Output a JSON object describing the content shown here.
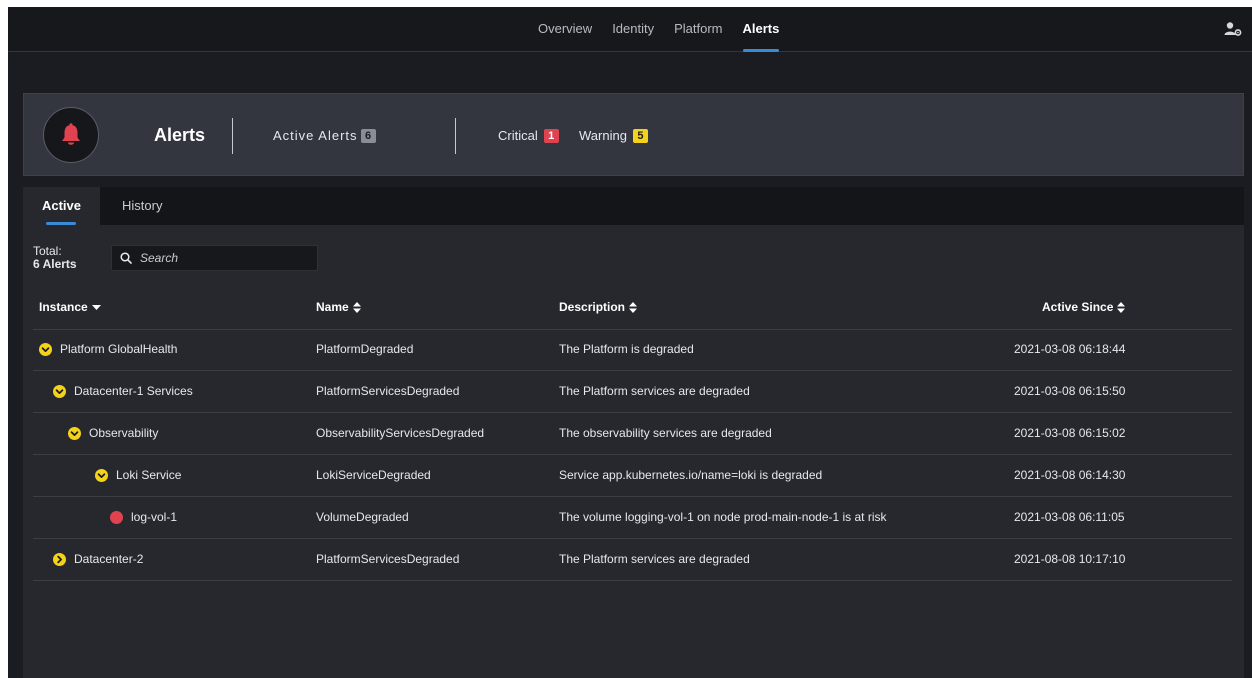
{
  "nav": {
    "tabs": [
      "Overview",
      "Identity",
      "Platform",
      "Alerts"
    ],
    "active": "Alerts",
    "user_icon": "user-settings-icon"
  },
  "header": {
    "icon": "bell-icon",
    "title": "Alerts",
    "active_alerts_label": "Active Alerts",
    "active_alerts_count": "6",
    "critical_label": "Critical",
    "critical_count": "1",
    "warning_label": "Warning",
    "warning_count": "5"
  },
  "tabs": {
    "active": "Active",
    "history": "History"
  },
  "toolbar": {
    "total_label": "Total:",
    "total_value": "6 Alerts",
    "search_placeholder": "Search"
  },
  "table": {
    "columns": {
      "instance": "Instance",
      "name": "Name",
      "description": "Description",
      "active_since": "Active Since"
    },
    "rows": [
      {
        "instance": "Platform GlobalHealth",
        "name": "PlatformDegraded",
        "description": "The Platform is degraded",
        "active_since": "2021-03-08 06:18:44",
        "status": "expanded",
        "depth": 0
      },
      {
        "instance": "Datacenter-1 Services",
        "name": "PlatformServicesDegraded",
        "description": "The Platform services are degraded",
        "active_since": "2021-03-08 06:15:50",
        "status": "expanded",
        "depth": 1
      },
      {
        "instance": "Observability",
        "name": "ObservabilityServicesDegraded",
        "description": "The observability services are degraded",
        "active_since": "2021-03-08 06:15:02",
        "status": "expanded",
        "depth": 2
      },
      {
        "instance": "Loki Service",
        "name": "LokiServiceDegraded",
        "description": "Service app.kubernetes.io/name=loki is degraded",
        "active_since": "2021-03-08 06:14:30",
        "status": "expanded",
        "depth": 3
      },
      {
        "instance": "log-vol-1",
        "name": "VolumeDegraded",
        "description": "The volume logging-vol-1 on node prod-main-node-1 is at risk",
        "active_since": "2021-03-08 06:11:05",
        "status": "critical",
        "depth": 4
      },
      {
        "instance": "Datacenter-2",
        "name": "PlatformServicesDegraded",
        "description": "The Platform services are degraded",
        "active_since": "2021-08-08 10:17:10",
        "status": "collapsed",
        "depth": 1
      }
    ]
  },
  "colors": {
    "warning": "#f4d21a",
    "critical": "#e0434f",
    "accent": "#3b8ad9"
  }
}
